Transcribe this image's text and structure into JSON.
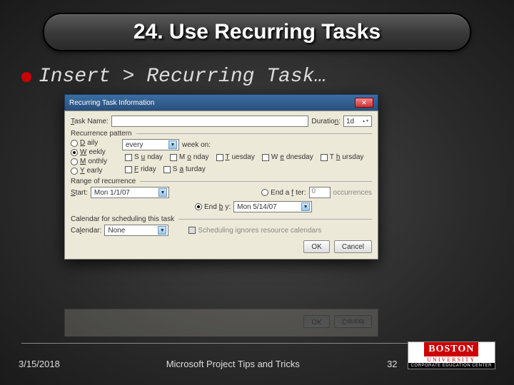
{
  "slide": {
    "title": "24. Use Recurring Tasks",
    "bullet_text": "Insert > Recurring Task…"
  },
  "dialog": {
    "window_title": "Recurring Task Information",
    "close_icon": "✕",
    "task_name_label": "Task Name:",
    "task_name_value": "",
    "duration_label": "Duration:",
    "duration_value": "1d",
    "recurrence_pattern_label": "Recurrence pattern",
    "radios": {
      "daily": "Daily",
      "weekly": "Weekly",
      "monthly": "Monthly",
      "yearly": "Yearly"
    },
    "freq_value": "every",
    "week_on_label": "week on:",
    "days": [
      "Sunday",
      "Monday",
      "Tuesday",
      "Wednesday",
      "Thursday",
      "Friday",
      "Saturday"
    ],
    "range_label": "Range of recurrence",
    "start_label": "Start:",
    "start_value": "Mon 1/1/07",
    "end_after_label": "End after:",
    "end_after_value": "0",
    "occurrences_label": "occurrences",
    "end_by_label": "End by:",
    "end_by_value": "Mon 5/14/07",
    "calendar_section_label": "Calendar for scheduling this task",
    "calendar_label": "Calendar:",
    "calendar_value": "None",
    "sched_ignore_label": "Scheduling ignores resource calendars",
    "ok_label": "OK",
    "cancel_label": "Cancel"
  },
  "footer": {
    "date": "3/15/2018",
    "center": "Microsoft Project Tips and Tricks",
    "page_number": "32",
    "logo": {
      "line1": "BOSTON",
      "line2": "UNIVERSITY",
      "line3": "CORPORATE EDUCATION CENTER"
    }
  }
}
